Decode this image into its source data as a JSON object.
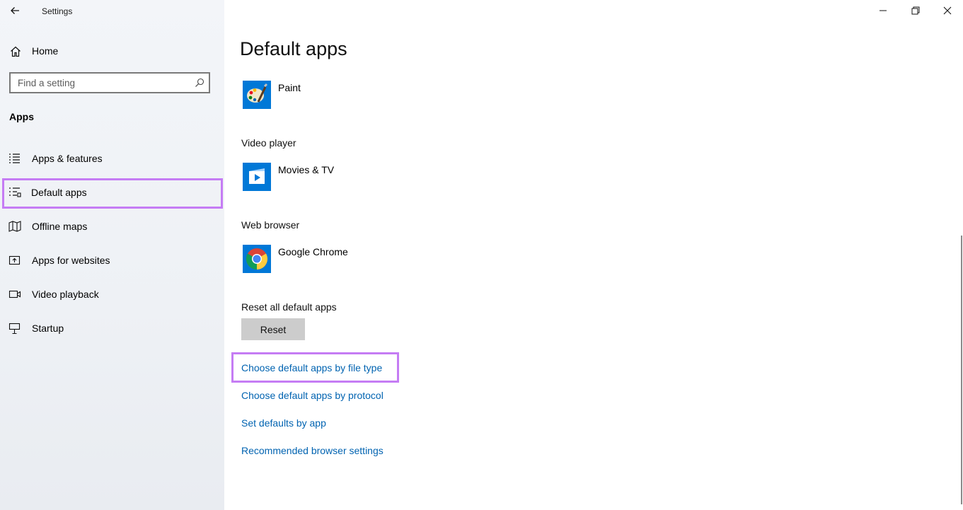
{
  "window": {
    "title": "Settings",
    "controls": [
      "minimize-icon",
      "restore-icon",
      "close-icon"
    ]
  },
  "sidebar": {
    "home_label": "Home",
    "search": {
      "placeholder": "Find a setting",
      "value": ""
    },
    "section_title": "Apps",
    "items": [
      {
        "label": "Apps & features",
        "icon": "apps-features-icon"
      },
      {
        "label": "Default apps",
        "icon": "default-apps-icon",
        "selected": true
      },
      {
        "label": "Offline maps",
        "icon": "map-icon"
      },
      {
        "label": "Apps for websites",
        "icon": "open-link-icon"
      },
      {
        "label": "Video playback",
        "icon": "video-icon"
      },
      {
        "label": "Startup",
        "icon": "startup-icon"
      }
    ]
  },
  "main": {
    "title": "Default apps",
    "photo_viewer": {
      "app": "Paint"
    },
    "video_player": {
      "label": "Video player",
      "app": "Movies & TV"
    },
    "web_browser": {
      "label": "Web browser",
      "app": "Google Chrome"
    },
    "reset": {
      "label": "Reset all default apps",
      "button": "Reset"
    },
    "links": [
      "Choose default apps by file type",
      "Choose default apps by protocol",
      "Set defaults by app",
      "Recommended browser settings"
    ]
  },
  "colors": {
    "accent_link": "#0063b1",
    "highlight": "#c57cf4",
    "tile_blue": "#0078d7"
  }
}
